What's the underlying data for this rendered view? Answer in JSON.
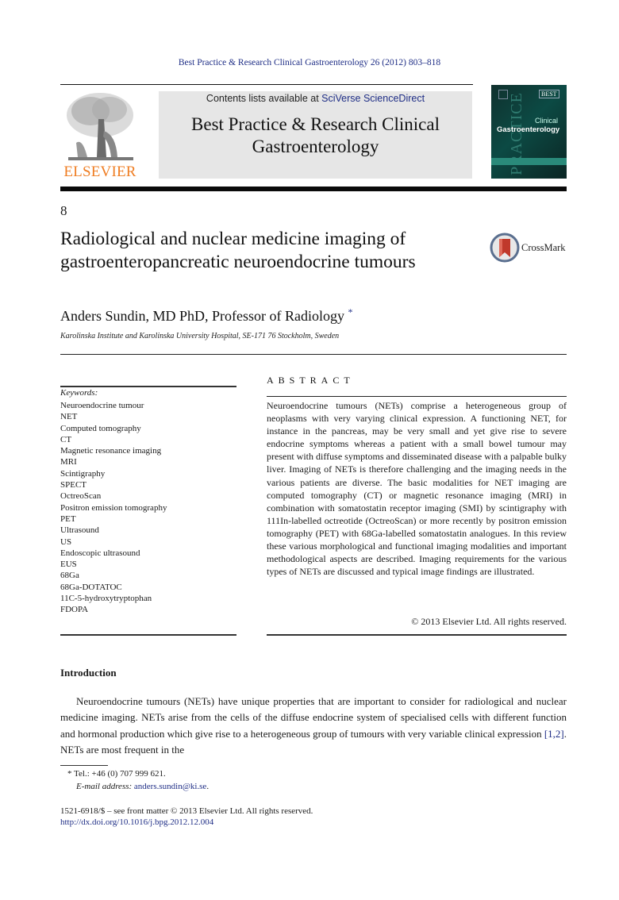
{
  "running_head": "Best Practice & Research Clinical Gastroenterology 26 (2012) 803–818",
  "header": {
    "publisher_logo_text": "ELSEVIER",
    "contents_prefix": "Contents lists available at ",
    "contents_link": "SciVerse ScienceDirect",
    "journal_title_line1": "Best Practice & Research Clinical",
    "journal_title_line2": "Gastroenterology",
    "cover": {
      "badge": "BEST",
      "vertical_text": "PRACTICE",
      "clinical": "Clinical",
      "gastro": "Gastroenterology",
      "accent_color": "#2a8a7a"
    }
  },
  "article": {
    "chapter_number": "8",
    "title": "Radiological and nuclear medicine imaging of gastroenteropancreatic neuroendocrine tumours",
    "crossmark_label": "CrossMark",
    "author": "Anders Sundin, MD PhD, Professor of Radiology",
    "author_marker": "*",
    "affiliation": "Karolinska Institute and Karolinska University Hospital, SE-171 76 Stockholm, Sweden"
  },
  "keywords": {
    "label": "Keywords:",
    "items": [
      "Neuroendocrine tumour",
      "NET",
      "Computed tomography",
      "CT",
      "Magnetic resonance imaging",
      "MRI",
      "Scintigraphy",
      "SPECT",
      "OctreoScan",
      "Positron emission tomography",
      "PET",
      "Ultrasound",
      "US",
      "Endoscopic ultrasound",
      "EUS",
      "68Ga",
      "68Ga-DOTATOC",
      "11C-5-hydroxytryptophan",
      "FDOPA"
    ]
  },
  "abstract": {
    "heading": "ABSTRACT",
    "text": "Neuroendocrine tumours (NETs) comprise a heterogeneous group of neoplasms with very varying clinical expression. A functioning NET, for instance in the pancreas, may be very small and yet give rise to severe endocrine symptoms whereas a patient with a small bowel tumour may present with diffuse symptoms and disseminated disease with a palpable bulky liver. Imaging of NETs is therefore challenging and the imaging needs in the various patients are diverse. The basic modalities for NET imaging are computed tomography (CT) or magnetic resonance imaging (MRI) in combination with somatostatin receptor imaging (SMI) by scintigraphy with 111In-labelled octreotide (OctreoScan) or more recently by positron emission tomography (PET) with 68Ga-labelled somatostatin analogues. In this review these various morphological and functional imaging modalities and important methodological aspects are described. Imaging requirements for the various types of NETs are discussed and typical image findings are illustrated.",
    "copyright": "© 2013 Elsevier Ltd. All rights reserved."
  },
  "introduction": {
    "heading": "Introduction",
    "text_before_ref": "Neuroendocrine tumours (NETs) have unique properties that are important to consider for radiological and nuclear medicine imaging. NETs arise from the cells of the diffuse endocrine system of specialised cells with different function and hormonal production which give rise to a heterogeneous group of tumours with very variable clinical expression ",
    "ref": "[1,2]",
    "text_after_ref": ". NETs are most frequent in the"
  },
  "footnotes": {
    "tel": "* Tel.: +46 (0) 707 999 621.",
    "email_label": "E-mail address: ",
    "email": "anders.sundin@ki.se",
    "email_suffix": ".",
    "front_matter": "1521-6918/$ – see front matter © 2013 Elsevier Ltd. All rights reserved.",
    "doi": "http://dx.doi.org/10.1016/j.bpg.2012.12.004"
  },
  "colors": {
    "link": "#1f2e86",
    "elsevier_orange": "#ef7d22",
    "journal_box_bg": "#e6e6e6"
  }
}
